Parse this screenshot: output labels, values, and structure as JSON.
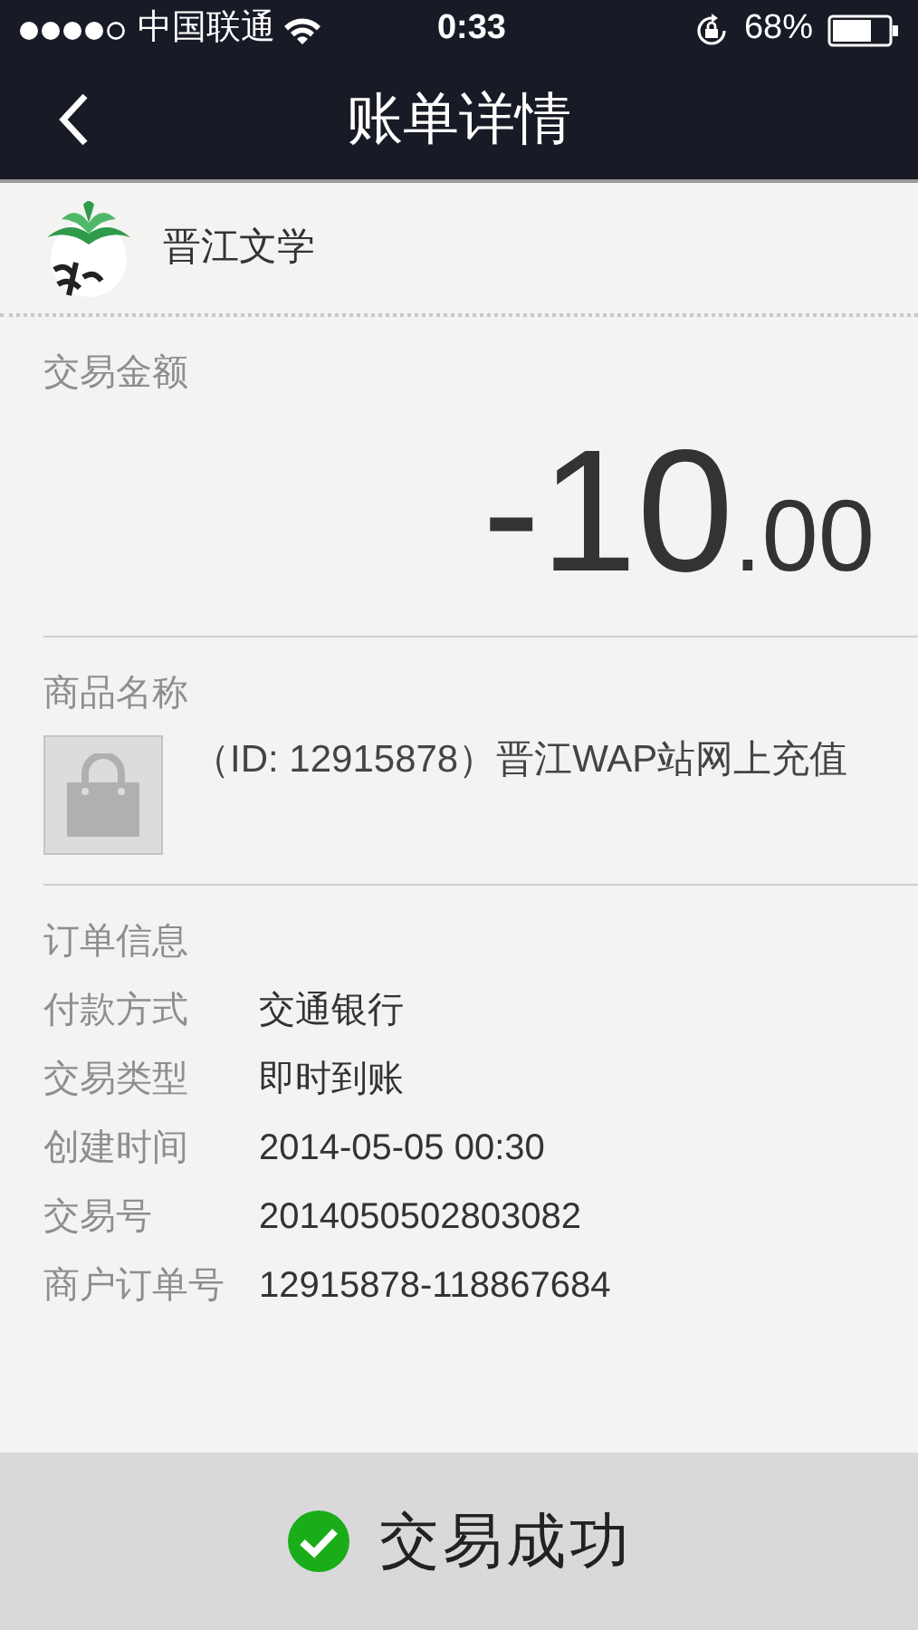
{
  "status_bar": {
    "carrier": "中国联通",
    "time": "0:33",
    "battery": "68%"
  },
  "nav": {
    "title": "账单详情"
  },
  "merchant": {
    "name": "晋江文学"
  },
  "amount": {
    "label": "交易金额",
    "integer": "-10",
    "fraction": ".00"
  },
  "product": {
    "label": "商品名称",
    "name": "（ID: 12915878）晋江WAP站网上充值"
  },
  "order": {
    "label": "订单信息",
    "fields": [
      {
        "label": "付款方式",
        "value": "交通银行"
      },
      {
        "label": "交易类型",
        "value": "即时到账"
      },
      {
        "label": "创建时间",
        "value": "2014-05-05 00:30"
      },
      {
        "label": "交易号",
        "value": "2014050502803082"
      },
      {
        "label": "商户订单号",
        "value": "12915878-118867684"
      }
    ]
  },
  "result": {
    "kind": "success",
    "text": "交易成功"
  }
}
